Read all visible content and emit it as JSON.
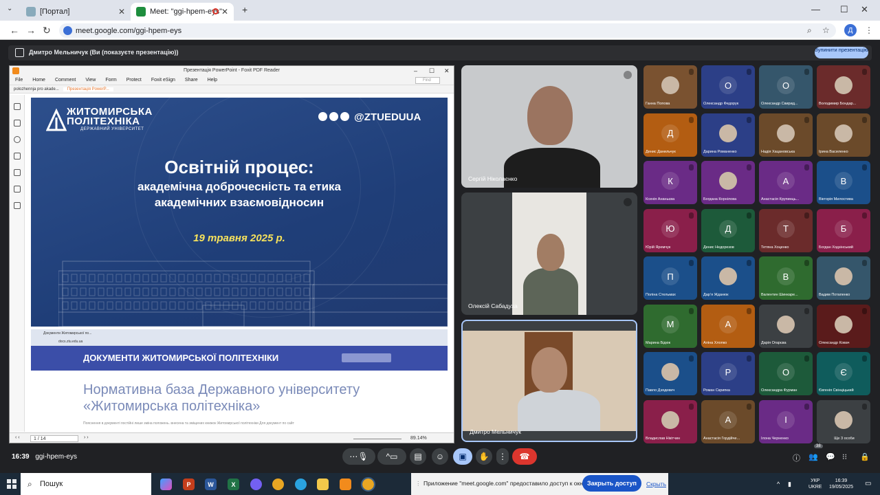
{
  "browser": {
    "tabs": [
      {
        "title": "[Портал]"
      },
      {
        "title": "Meet: \"ggi-hpem-eys\""
      }
    ],
    "new_tab": "+",
    "url": "meet.google.com/ggi-hpem-eys",
    "profile_initial": "Д"
  },
  "meet": {
    "presenting_banner": "Дмитро Мельничук (Ви (показуєте презентацію))",
    "stop_presenting": "Зупинити презентацію",
    "time": "16:39",
    "meeting_code": "ggi-hpem-eys",
    "participant_count": "38"
  },
  "foxit": {
    "title": "Презентація PowerPoint - Foxit PDF Reader",
    "menu": [
      "File",
      "Home",
      "Comment",
      "View",
      "Form",
      "Protect",
      "Foxit eSign",
      "Share",
      "Help"
    ],
    "find_placeholder": "Find",
    "doc_tabs": [
      "polozhennja pro akade...",
      "Презентація PowerP..."
    ],
    "page_indicator": "1 / 14",
    "zoom": "89.14%"
  },
  "slide": {
    "logo_line1": "ЖИТОМИРСЬКА",
    "logo_line2": "ПОЛІТЕХНІКА",
    "logo_sub": "ДЕРЖАВНИЙ УНІВЕРСИТЕТ",
    "social_handle": "@ZTUEDUUA",
    "title": "Освітній процес:",
    "subtitle1": "академічна доброчесність та етика",
    "subtitle2": "академічних взаємовідносин",
    "date": "19 травня 2025 р."
  },
  "page2": {
    "browser_tab": "Документи Житомирської по...",
    "url": "docs.ztu.edu.ua",
    "header": "ДОКУМЕНТИ ЖИТОМИРСЬКОЇ ПОЛІТЕХНІКИ",
    "heading_line1": "Нормативна база Державного університету",
    "heading_line2": "«Житомирська політехніка»",
    "small_text": "Пояснення в документі  постійні лише зміна положень.  внесена та  зміщених книжок Житомирської політехніки  Для документ по сайт"
  },
  "videos": [
    {
      "name": "Сергій Ніколаєнко"
    },
    {
      "name": "Олексій Сабадуха"
    },
    {
      "name": "Дмитро Мельничук"
    }
  ],
  "participants": [
    {
      "name": "Ганна Попова",
      "initial": "",
      "bg": "#7a5230"
    },
    {
      "name": "Олександр Федорук",
      "initial": "О",
      "bg": "#2c3f87"
    },
    {
      "name": "Олександр Свирид...",
      "initial": "О",
      "bg": "#35566b"
    },
    {
      "name": "Володимир Бондар...",
      "initial": "",
      "bg": "#6b2b2b"
    },
    {
      "name": "Денис Данильчук",
      "initial": "Д",
      "bg": "#b35d12"
    },
    {
      "name": "Дарина Романенко",
      "initial": "",
      "bg": "#2c3f87"
    },
    {
      "name": "Надія Хацановська",
      "initial": "",
      "bg": "#6b4a2a"
    },
    {
      "name": "Ірина Василенко",
      "initial": "",
      "bg": "#6b4a2a"
    },
    {
      "name": "Ксенія Ананьєва",
      "initial": "К",
      "bg": "#6a2b86"
    },
    {
      "name": "Богдана Корнілова",
      "initial": "",
      "bg": "#6a2b86"
    },
    {
      "name": "Анастасія Крупинць...",
      "initial": "А",
      "bg": "#6a2b86"
    },
    {
      "name": "Вікторія Милостива",
      "initial": "В",
      "bg": "#1b4f8a"
    },
    {
      "name": "Юрій Яремчук",
      "initial": "Ю",
      "bg": "#8a1f4a"
    },
    {
      "name": "Денис Недорезов",
      "initial": "Д",
      "bg": "#1d5a3a"
    },
    {
      "name": "Тетяна Хоценко",
      "initial": "Т",
      "bg": "#6b2b2b"
    },
    {
      "name": "Богдан Ходзінський",
      "initial": "Б",
      "bg": "#8a1f4a"
    },
    {
      "name": "Поліна Стельмах",
      "initial": "П",
      "bg": "#1b4f8a"
    },
    {
      "name": "Дар’я Жданюк",
      "initial": "",
      "bg": "#1b4f8a"
    },
    {
      "name": "Валентин Шинкаре...",
      "initial": "В",
      "bg": "#2f6b2f"
    },
    {
      "name": "Вадим Потапенко",
      "initial": "",
      "bg": "#35566b"
    },
    {
      "name": "Марина Бідюк",
      "initial": "М",
      "bg": "#2f6b2f"
    },
    {
      "name": "Аліна Хлопко",
      "initial": "А",
      "bg": "#b35d12"
    },
    {
      "name": "Дарія Огарєва",
      "initial": "",
      "bg": "#3c4043"
    },
    {
      "name": "Олександр Ковач",
      "initial": "",
      "bg": "#5a1b1b"
    },
    {
      "name": "Павло Дзядевич",
      "initial": "",
      "bg": "#1b4f8a"
    },
    {
      "name": "Роман Скрипка",
      "initial": "Р",
      "bg": "#2c3f87"
    },
    {
      "name": "Олександра Фурман",
      "initial": "О",
      "bg": "#1d5a3a"
    },
    {
      "name": "Євгенія Свінціцький",
      "initial": "Є",
      "bg": "#0f5c5c"
    },
    {
      "name": "Владислав Нікітчин",
      "initial": "",
      "bg": "#8a1f4a"
    },
    {
      "name": "Анастасія Гордійче...",
      "initial": "А",
      "bg": "#6b4a2a"
    },
    {
      "name": "Ілона Черненко",
      "initial": "І",
      "bg": "#6a2b86"
    },
    {
      "name": "Ще 3 особи",
      "initial": "",
      "bg": "#3c4043"
    }
  ],
  "taskbar": {
    "search": "Пошук",
    "notification": "Приложение \"meet.google.com\" предоставило доступ к окну.",
    "close_access": "Закрыть доступ",
    "hide": "Скрыть",
    "lang1": "УКР",
    "lang2": "UKRE",
    "time": "16:39",
    "date": "19/05/2025"
  },
  "colors": {
    "meet_bg": "#202124",
    "present_blue": "#a8c7fa",
    "hangup_red": "#dc362e",
    "slide_blue": "#2d4f8c",
    "slide_date_yellow": "#f7e25c"
  }
}
